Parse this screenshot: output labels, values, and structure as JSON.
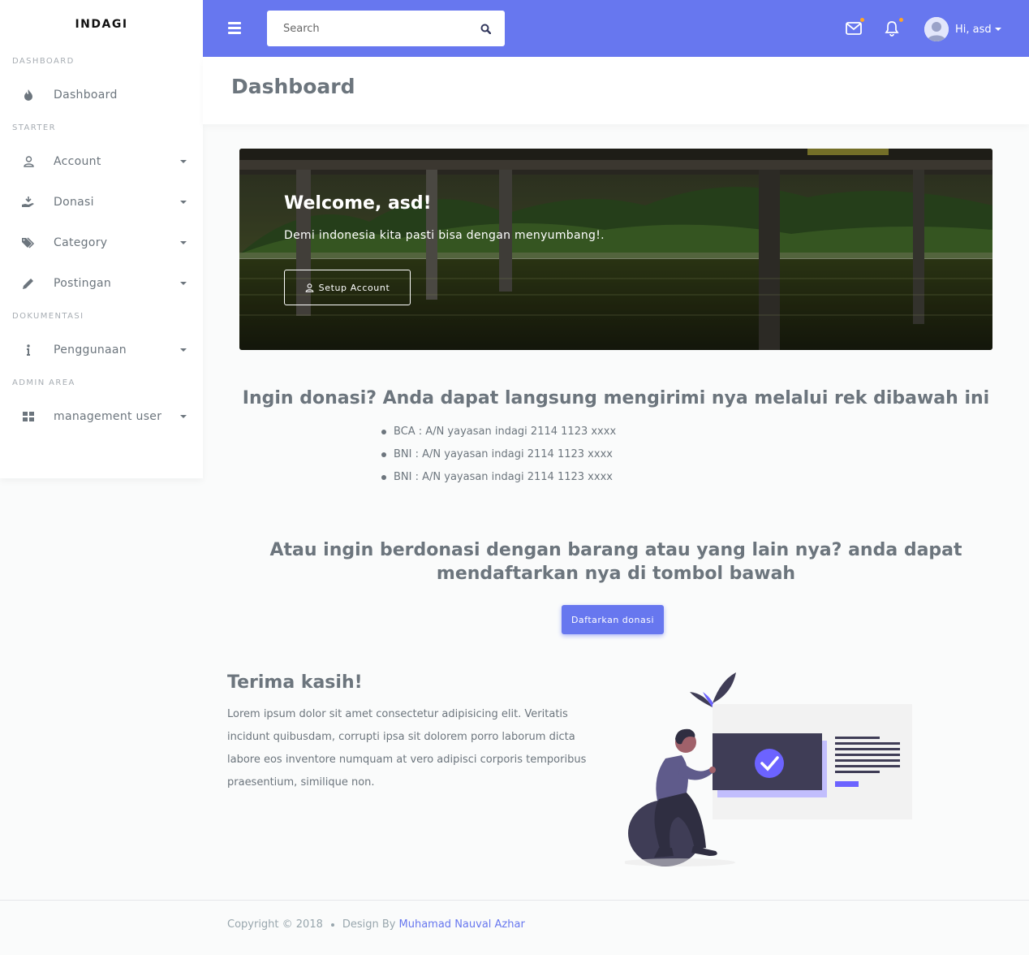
{
  "brand": "INDAGI",
  "sidebar": {
    "sections": [
      {
        "header": "DASHBOARD",
        "items": [
          {
            "label": "Dashboard",
            "icon": "fire-icon",
            "dropdown": false
          }
        ]
      },
      {
        "header": "STARTER",
        "items": [
          {
            "label": "Account",
            "icon": "user-icon",
            "dropdown": true
          },
          {
            "label": "Donasi",
            "icon": "hand-holding-icon",
            "dropdown": true
          },
          {
            "label": "Category",
            "icon": "tags-icon",
            "dropdown": true
          },
          {
            "label": "Postingan",
            "icon": "pencil-icon",
            "dropdown": true
          }
        ]
      },
      {
        "header": "DOKUMENTASI",
        "items": [
          {
            "label": "Penggunaan",
            "icon": "info-icon",
            "dropdown": true
          }
        ]
      },
      {
        "header": "ADMIN AREA",
        "items": [
          {
            "label": "management user",
            "icon": "grid-icon",
            "dropdown": true
          }
        ]
      }
    ]
  },
  "topbar": {
    "search_placeholder": "Search",
    "user_greeting": "Hi, asd",
    "accent_color": "#6777ef",
    "notification_dot_color": "#ffa426"
  },
  "page": {
    "title": "Dashboard"
  },
  "hero": {
    "title": "Welcome, asd!",
    "subtitle": "Demi indonesia kita pasti bisa dengan menyumbang!.",
    "button_label": "Setup Account"
  },
  "donasi": {
    "title": "Ingin donasi? Anda dapat langsung mengirimi nya melalui rek dibawah ini",
    "accounts": [
      "BCA : A/N yayasan indagi 2114 1123 xxxx",
      "BNI : A/N yayasan indagi 2114 1123 xxxx",
      "BNI : A/N yayasan indagi 2114 1123 xxxx"
    ]
  },
  "barang": {
    "title": "Atau ingin berdonasi dengan barang atau yang lain nya? anda dapat mendaftarkan nya di tombol bawah",
    "button_label": "Daftarkan donasi"
  },
  "thanks": {
    "title": "Terima kasih!",
    "text": "Lorem ipsum dolor sit amet consectetur adipisicing elit. Veritatis incidunt quibusdam, corrupti ipsa sit dolorem porro laborum dicta labore eos inventore numquam at vero adipisci corporis temporibus praesentium, similique non."
  },
  "footer": {
    "copyright": "Copyright © 2018",
    "design_by": "Design By",
    "author": "Muhamad Nauval Azhar"
  }
}
